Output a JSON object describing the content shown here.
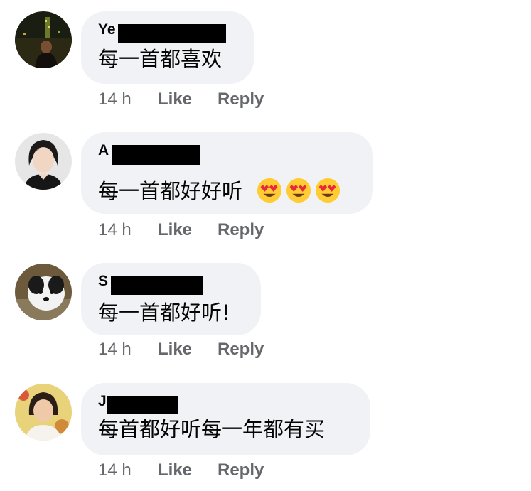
{
  "comments": [
    {
      "name": "Ye",
      "text": "每一首都喜欢",
      "time": "14 h",
      "like": "Like",
      "reply": "Reply",
      "emoji_count": 0
    },
    {
      "name": "A",
      "text": "每一首都好好听",
      "time": "14 h",
      "like": "Like",
      "reply": "Reply",
      "emoji_count": 3,
      "emoji": "smiling-face-with-heart-eyes"
    },
    {
      "name": "S",
      "text": "每一首都好听!",
      "time": "14 h",
      "like": "Like",
      "reply": "Reply",
      "emoji_count": 0
    },
    {
      "name": "J",
      "text": "每首都好听每一年都有买",
      "time": "14 h",
      "like": "Like",
      "reply": "Reply",
      "emoji_count": 0
    }
  ],
  "colors": {
    "bubble": "#f0f2f5",
    "secondary_text": "#65676b",
    "primary_text": "#050505",
    "redaction": "#000000"
  }
}
